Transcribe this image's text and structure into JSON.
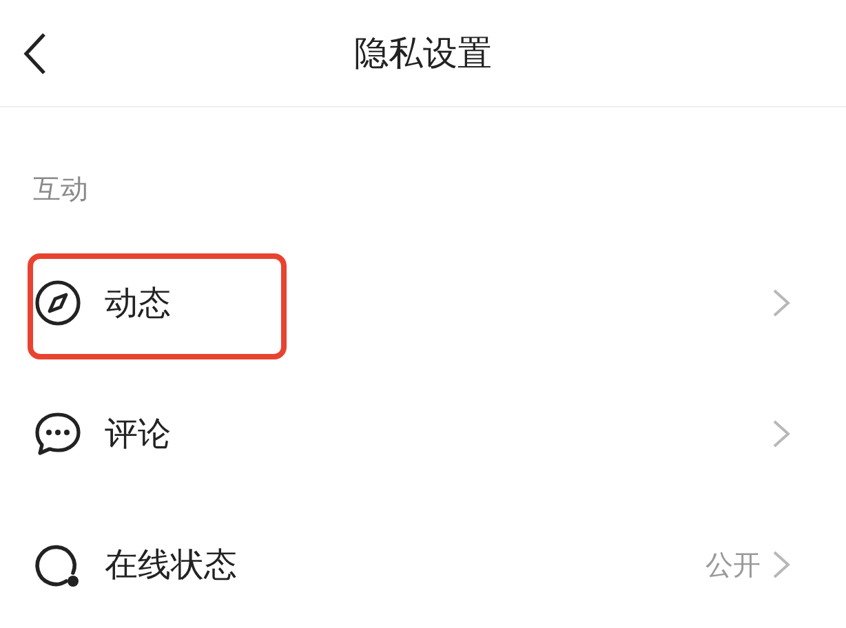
{
  "header": {
    "title": "隐私设置"
  },
  "section": {
    "label": "互动"
  },
  "items": [
    {
      "kind": "compass",
      "label": "动态",
      "highlighted": true
    },
    {
      "kind": "chat",
      "label": "评论",
      "highlighted": false
    },
    {
      "kind": "status",
      "label": "在线状态",
      "value": "公开",
      "highlighted": false
    }
  ]
}
